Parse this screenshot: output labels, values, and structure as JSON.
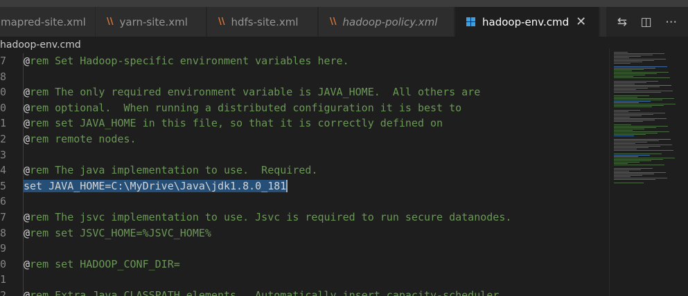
{
  "tabs": [
    {
      "label": "mapred-site.xml",
      "icon": "rss-icon"
    },
    {
      "label": "yarn-site.xml",
      "icon": "rss-icon"
    },
    {
      "label": "hdfs-site.xml",
      "icon": "rss-icon"
    },
    {
      "label": "hadoop-policy.xml",
      "icon": "rss-icon",
      "italic": true
    },
    {
      "label": "hadoop-env.cmd",
      "icon": "windows-icon",
      "active": true
    }
  ],
  "breadcrumb": "hadoop-env.cmd",
  "lines": [
    {
      "num": "7",
      "at": "@",
      "kw": "rem",
      "text": " Set Hadoop-specific environment variables here."
    },
    {
      "num": "8",
      "at": "",
      "kw": "",
      "text": ""
    },
    {
      "num": "0",
      "at": "@",
      "kw": "rem",
      "text": " The only required environment variable is JAVA_HOME.  All others are"
    },
    {
      "num": "0",
      "at": "@",
      "kw": "rem",
      "text": " optional.  When running a distributed configuration it is best to"
    },
    {
      "num": "1",
      "at": "@",
      "kw": "rem",
      "text": " set JAVA_HOME in this file, so that it is correctly defined on"
    },
    {
      "num": "2",
      "at": "@",
      "kw": "rem",
      "text": " remote nodes."
    },
    {
      "num": "3",
      "at": "",
      "kw": "",
      "text": ""
    },
    {
      "num": "4",
      "at": "@",
      "kw": "rem",
      "text": " The java implementation to use.  Required."
    },
    {
      "num": "5",
      "at": "",
      "kw": "",
      "text": "",
      "selected": "set JAVA_HOME=C:\\MyDrive\\Java\\jdk1.8.0_181"
    },
    {
      "num": "6",
      "at": "",
      "kw": "",
      "text": ""
    },
    {
      "num": "7",
      "at": "@",
      "kw": "rem",
      "text": " The jsvc implementation to use. Jsvc is required to run secure datanodes."
    },
    {
      "num": "8",
      "at": "@",
      "kw": "rem",
      "text": " set JSVC_HOME=%JSVC_HOME%"
    },
    {
      "num": "9",
      "at": "",
      "kw": "",
      "text": ""
    },
    {
      "num": "0",
      "at": "@",
      "kw": "rem",
      "text": " set HADOOP_CONF_DIR="
    },
    {
      "num": "1",
      "at": "",
      "kw": "",
      "text": ""
    },
    {
      "num": "2",
      "at": "@",
      "kw": "rem",
      "text": " Extra Java CLASSPATH elements.  Automatically insert capacity-scheduler."
    }
  ],
  "colors": {
    "comment": "#6a9955",
    "selection": "#264f78",
    "tab_active": "#1e1e1e",
    "rss": "#e37933",
    "windows": "#3ba0e6"
  }
}
